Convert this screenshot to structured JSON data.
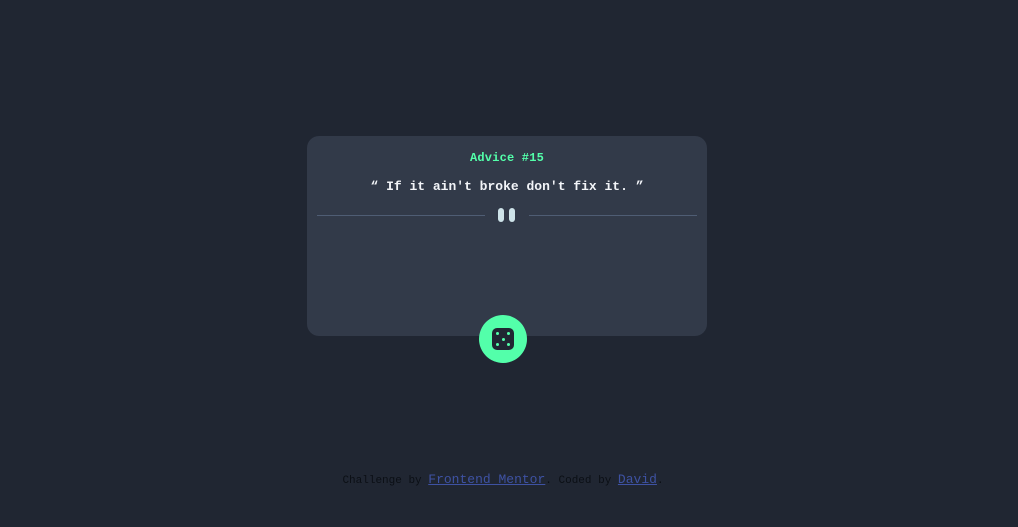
{
  "card": {
    "title": "Advice #15",
    "quote": "“ If it ain't broke don't fix it. ”"
  },
  "icons": {
    "divider": "pause-icon",
    "button": "dice-icon"
  },
  "colors": {
    "background": "#202632",
    "card": "#323a49",
    "accent": "#53ffaa",
    "text": "#f2f4f8",
    "link": "#3e52a3"
  },
  "footer": {
    "prefix": "Challenge by ",
    "link1": "Frontend Mentor",
    "middle": ". Coded by ",
    "link2": "David",
    "suffix": "."
  }
}
